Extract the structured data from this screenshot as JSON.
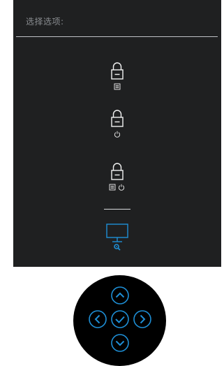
{
  "osd": {
    "title": "选择选项:",
    "options": [
      {
        "icon": "lock-menu-icon",
        "label_icon": "menu-icon"
      },
      {
        "icon": "lock-power-icon",
        "label_icon": "power-icon"
      },
      {
        "icon": "lock-menu-power-icon",
        "label_icon": "menu-power-icon"
      },
      {
        "icon": "monitor-diagnostics-icon",
        "selected": true
      }
    ]
  },
  "colors": {
    "panel_bg": "#1f2021",
    "icon_white": "#f2f2f2",
    "title_gray": "#8a8d91",
    "accent_blue": "#1e8fd6",
    "joystick_bg": "#000000"
  },
  "joystick": {
    "buttons": [
      "up",
      "left",
      "ok",
      "right",
      "down"
    ]
  }
}
